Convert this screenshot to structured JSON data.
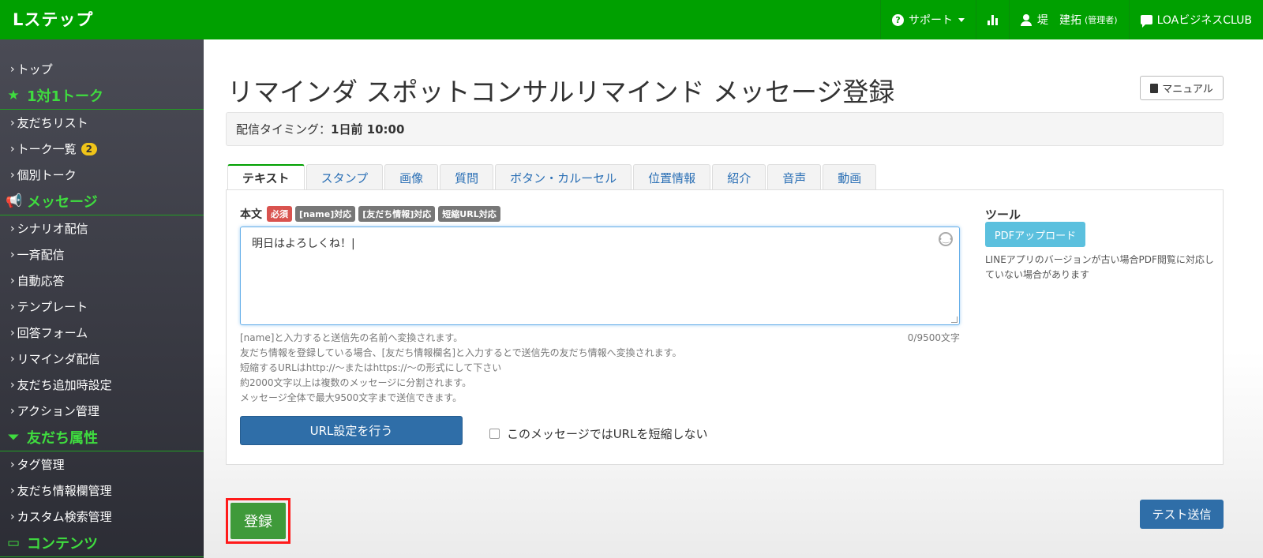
{
  "header": {
    "logo": "Lステップ",
    "support_label": "サポート",
    "user_name": "堤　建拓",
    "user_role": "(管理者)",
    "club_label": "LOAビジネスCLUB"
  },
  "sidebar": {
    "items": [
      {
        "type": "item",
        "label": "トップ"
      },
      {
        "type": "head",
        "icon": "★",
        "label": "1対1トーク"
      },
      {
        "type": "item",
        "label": "友だちリスト"
      },
      {
        "type": "item",
        "label": "トーク一覧",
        "badge": "2"
      },
      {
        "type": "item",
        "label": "個別トーク"
      },
      {
        "type": "head",
        "icon": "📢",
        "label": "メッセージ"
      },
      {
        "type": "item",
        "label": "シナリオ配信"
      },
      {
        "type": "item",
        "label": "一斉配信"
      },
      {
        "type": "item",
        "label": "自動応答"
      },
      {
        "type": "item",
        "label": "テンプレート"
      },
      {
        "type": "item",
        "label": "回答フォーム"
      },
      {
        "type": "item",
        "label": "リマインダ配信"
      },
      {
        "type": "item",
        "label": "友だち追加時設定"
      },
      {
        "type": "item",
        "label": "アクション管理"
      },
      {
        "type": "head",
        "icon": "⏷",
        "label": "友だち属性"
      },
      {
        "type": "item",
        "label": "タグ管理"
      },
      {
        "type": "item",
        "label": "友だち情報欄管理"
      },
      {
        "type": "item",
        "label": "カスタム検索管理"
      },
      {
        "type": "head",
        "icon": "▭",
        "label": "コンテンツ"
      }
    ]
  },
  "page": {
    "title": "リマインダ スポットコンサルリマインド メッセージ登録",
    "manual_label": "マニュアル",
    "timing_label": "配信タイミング：",
    "timing_value": "1日前 10:00"
  },
  "tabs": [
    "テキスト",
    "スタンプ",
    "画像",
    "質問",
    "ボタン・カルーセル",
    "位置情報",
    "紹介",
    "音声",
    "動画"
  ],
  "editor": {
    "label": "本文",
    "tags": [
      {
        "text": "必須",
        "color": "#d9534f"
      },
      {
        "text": "[name]対応",
        "color": "#777777"
      },
      {
        "text": "[友だち情報]対応",
        "color": "#777777"
      },
      {
        "text": "短縮URL対応",
        "color": "#777777"
      }
    ],
    "value": "明日はよろしくね！|",
    "counter": "0/9500文字",
    "help_lines": [
      "[name]と入力すると送信先の名前へ変換されます。",
      "友だち情報を登録している場合、[友だち情報欄名]と入力するとで送信先の友だち情報へ変換されます。",
      "短縮するURLはhttp://〜またはhttps://〜の形式にして下さい",
      "約2000文字以上は複数のメッセージに分割されます。",
      "メッセージ全体で最大9500文字まで送信できます。"
    ],
    "url_button": "URL設定を行う",
    "no_shorten_label": "このメッセージではURLを短縮しない"
  },
  "tools": {
    "title": "ツール",
    "pdf_button": "PDFアップロード",
    "note": "LINEアプリのバージョンが古い場合PDF閲覧に対応していない場合があります"
  },
  "actions": {
    "submit": "登録",
    "test_send": "テスト送信"
  },
  "colors": {
    "brand_green": "#00a000",
    "primary_blue": "#2f6ea8",
    "info_cyan": "#5bc0de",
    "highlight_red": "#ff1a1a"
  }
}
